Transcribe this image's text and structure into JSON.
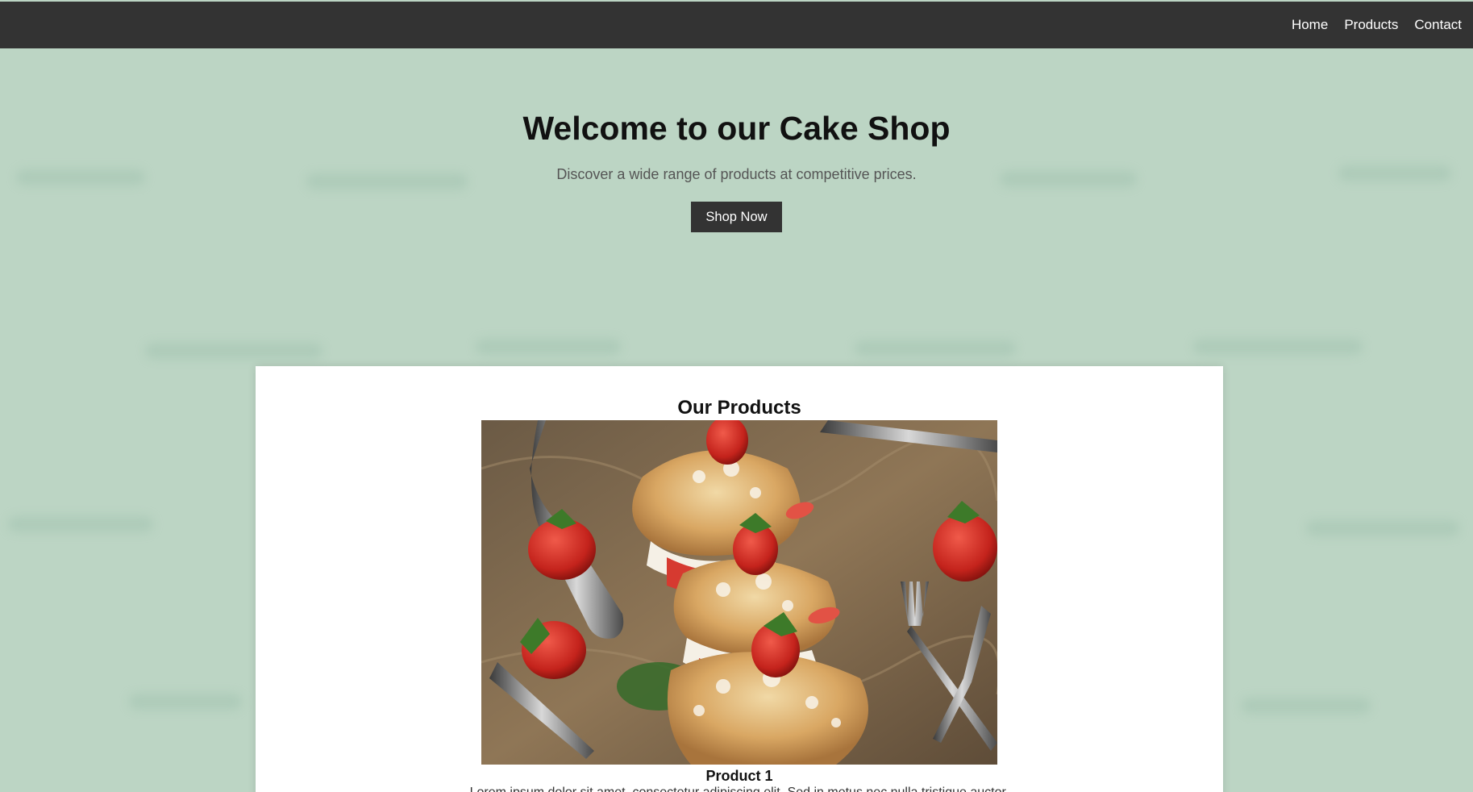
{
  "nav": {
    "items": [
      "Home",
      "Products",
      "Contact"
    ]
  },
  "hero": {
    "title": "Welcome to our Cake Shop",
    "subtitle": "Discover a wide range of products at competitive prices.",
    "cta_label": "Shop Now"
  },
  "products": {
    "heading": "Our Products",
    "items": [
      {
        "name": "Product 1",
        "description": "Lorem ipsum dolor sit amet, consectetur adipiscing elit. Sed in metus nec nulla tristique auctor."
      }
    ]
  },
  "colors": {
    "background": "#bcd5c4",
    "navbar": "#333333",
    "button": "#333333",
    "card": "#ffffff"
  }
}
